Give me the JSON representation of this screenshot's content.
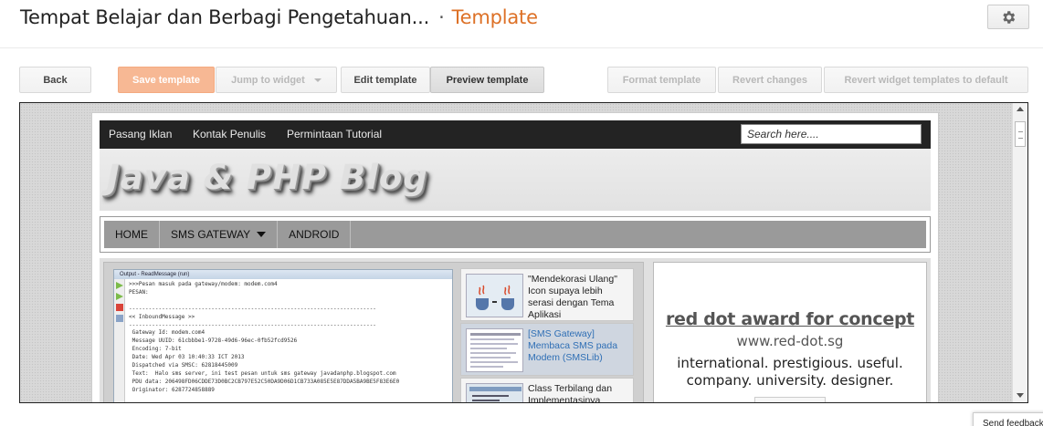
{
  "header": {
    "blog_title": "Tempat Belajar dan Berbagi Pengetahuan...",
    "separator": "·",
    "section": "Template"
  },
  "toolbar": {
    "back": "Back",
    "save": "Save template",
    "jump": "Jump to widget",
    "edit": "Edit template",
    "preview": "Preview template",
    "format": "Format template",
    "revert": "Revert changes",
    "revert_widgets": "Revert widget templates to default"
  },
  "preview": {
    "topnav": [
      "Pasang Iklan",
      "Kontak Penulis",
      "Permintaan Tutorial"
    ],
    "search_placeholder": "Search here....",
    "logo": "Java & PHP Blog",
    "mainnav": [
      "HOME",
      "SMS GATEWAY",
      "ANDROID"
    ],
    "slider": {
      "window_title": "Output - ReadMessage (run)",
      "output": ">>>Pesan masuk pada gateway/modem: modem.com4\nPESAN:\n\n---------------------------------------------------------------------------\n<< InboundMessage >>\n---------------------------------------------------------------------------\n Gateway Id: modem.com4\n Message UUID: 61cbbbe1-9728-49d6-96ec-0fb52fcd9526\n Encoding: 7-bit\n Date: Wed Apr 03 10:40:33 ICT 2013\n Dispatched via SMSC: 62818445009\n Text:  Halo sms server, ini test pesan untuk sms gateway javadanphp.blogspot.com\n PDU data: 206498FD06CDDE73D0BC2CB797E52C50DA9D06D1CB733A085E5E87DDA5BA9BE5F83E6E0\n Originator: 6287724858889",
      "items": [
        {
          "text": "\"Mendekorasi Ulang\" Icon supaya lebih serasi dengan Tema Aplikasi"
        },
        {
          "text": "[SMS Gateway] Membaca SMS pada Modem (SMSLib)"
        },
        {
          "text": "Class Terbilang dan Implementasinya"
        }
      ]
    },
    "ad": {
      "headline": "red dot award for concept",
      "url": "www.red-dot.sg",
      "line1": "international. prestigious. useful.",
      "line2": "company. university. designer."
    }
  },
  "feedback": "Send feedback",
  "colors": {
    "accent": "#dd7127",
    "save_button": "#f7b894",
    "link_blue": "#2f6fb5",
    "nav_dark": "#232323"
  }
}
